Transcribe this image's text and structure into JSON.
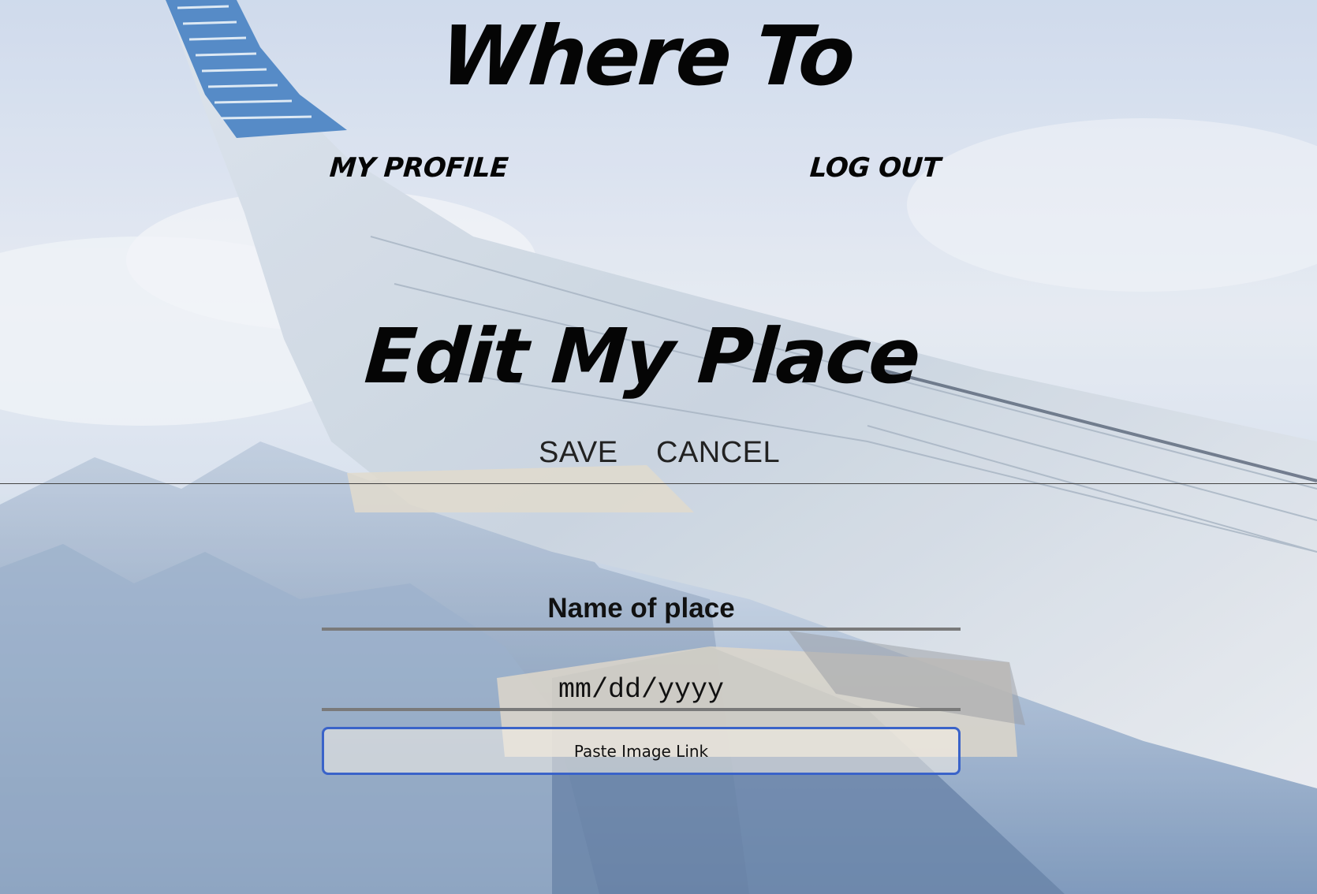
{
  "header": {
    "app_title": "Where To",
    "nav": {
      "profile_label": "MY PROFILE",
      "logout_label": "LOG OUT"
    }
  },
  "main": {
    "page_title": "Edit My Place",
    "actions": {
      "save_label": "SAVE",
      "cancel_label": "CANCEL"
    },
    "form": {
      "name_placeholder": "Name of place",
      "date_placeholder": "mm/dd/yyyy",
      "image_link_placeholder": "Paste Image Link"
    }
  },
  "colors": {
    "text": "#050505",
    "focus_border": "#3a63c9",
    "field_underline": "#7a7a7a"
  },
  "background": {
    "description_icon": "airplane-wing-photo"
  }
}
